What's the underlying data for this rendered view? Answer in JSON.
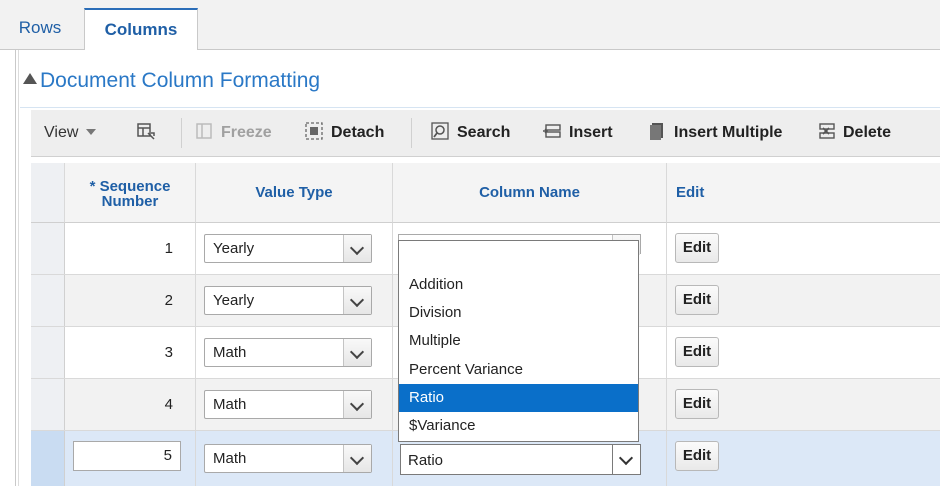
{
  "tabs": [
    {
      "label": "Rows",
      "active": false
    },
    {
      "label": "Columns",
      "active": true
    }
  ],
  "section": {
    "title": "Document Column Formatting",
    "collapse_icon": "triangle-up-icon"
  },
  "toolbar": {
    "view_label": "View",
    "freeze_label": "Freeze",
    "detach_label": "Detach",
    "search_label": "Search",
    "insert_label": "Insert",
    "insert_multiple_label": "Insert Multiple",
    "delete_label": "Delete"
  },
  "table": {
    "headers": {
      "sequence": "* Sequence Number",
      "value_type": "Value Type",
      "column_name": "Column Name",
      "edit": "Edit"
    },
    "rows": [
      {
        "seq": "1",
        "value_type": "Yearly",
        "column_name": "",
        "edit": "Edit"
      },
      {
        "seq": "2",
        "value_type": "Yearly",
        "column_name": "",
        "edit": "Edit"
      },
      {
        "seq": "3",
        "value_type": "Math",
        "column_name": "",
        "edit": "Edit"
      },
      {
        "seq": "4",
        "value_type": "Math",
        "column_name": "",
        "edit": "Edit"
      },
      {
        "seq": "5",
        "value_type": "Math",
        "column_name": "Ratio",
        "edit": "Edit"
      }
    ]
  },
  "dropdown": {
    "options": [
      "Addition",
      "Division",
      "Multiple",
      "Percent Variance",
      "Ratio",
      "$Variance"
    ],
    "highlighted": "Ratio"
  },
  "colors": {
    "accent": "#1f5fa6",
    "highlight": "#0a6fc9",
    "selected_row": "#dce8f7"
  }
}
